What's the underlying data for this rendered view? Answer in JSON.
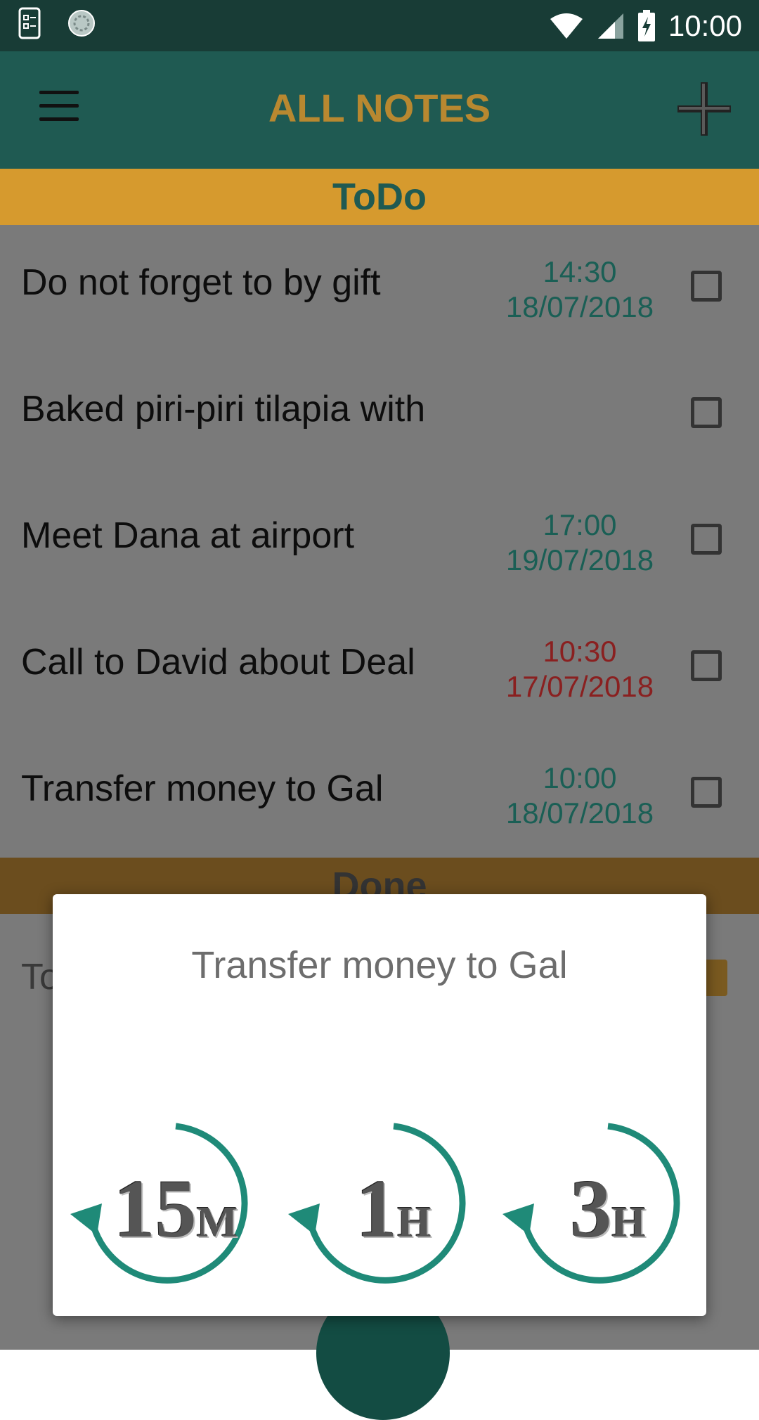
{
  "status_bar": {
    "time": "10:00"
  },
  "app_bar": {
    "title": "ALL NOTES"
  },
  "sections": {
    "todo": "ToDo",
    "done": "Done"
  },
  "todo_items": [
    {
      "title": "Do not forget to by gift",
      "time": "14:30",
      "date": "18/07/2018",
      "overdue": false
    },
    {
      "title": "Baked piri-piri tilapia with",
      "time": "",
      "date": "",
      "overdue": false
    },
    {
      "title": "Meet Dana at airport",
      "time": "17:00",
      "date": "19/07/2018",
      "overdue": false
    },
    {
      "title": "Call to David about Deal",
      "time": "10:30",
      "date": "17/07/2018",
      "overdue": true
    },
    {
      "title": "Transfer money to Gal",
      "time": "10:00",
      "date": "18/07/2018",
      "overdue": false
    }
  ],
  "done_items": [
    {
      "title": "To"
    }
  ],
  "dialog": {
    "title": "Transfer money to Gal",
    "snooze_options": [
      {
        "number": "15",
        "unit": "M"
      },
      {
        "number": "1",
        "unit": "H"
      },
      {
        "number": "3",
        "unit": "H"
      }
    ]
  },
  "colors": {
    "app_bar": "#1f5a52",
    "title": "#b88830",
    "todo_header": "#d69a2e",
    "time_green": "#1a5f55",
    "time_red": "#8a2020",
    "snooze_arrow": "#1f8a78"
  }
}
